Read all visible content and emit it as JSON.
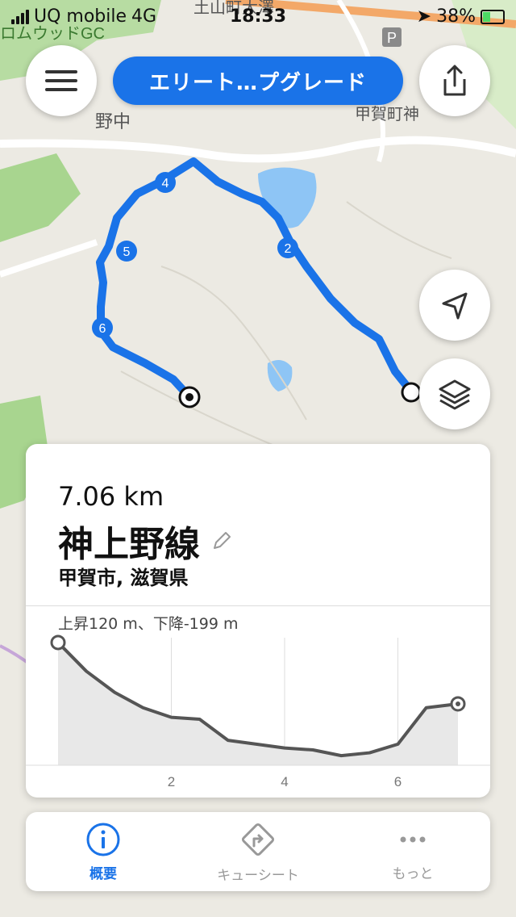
{
  "status_bar": {
    "carrier": "UQ mobile",
    "network": "4G",
    "time": "18:33",
    "battery": "38%"
  },
  "map": {
    "labels": [
      "ロムウッドGC",
      "野中",
      "甲賀町神",
      "土山町大澤",
      "P"
    ],
    "waypoints": [
      "4",
      "5",
      "6",
      "2"
    ]
  },
  "header": {
    "upgrade_label": "エリート…プグレード"
  },
  "route_card": {
    "distance": "7.06 km",
    "name": "神上野線",
    "location": "甲賀市, 滋賀県",
    "elevation_summary": "上昇120 m、下降-199 m"
  },
  "chart_data": {
    "type": "area",
    "x_ticks": [
      "2",
      "4",
      "6"
    ],
    "xlabel": "",
    "ylabel": "",
    "x": [
      0,
      0.5,
      1,
      1.5,
      2,
      2.5,
      3,
      3.5,
      4,
      4.5,
      5,
      5.5,
      6,
      6.5,
      7.06
    ],
    "y": [
      120,
      90,
      68,
      52,
      42,
      40,
      18,
      14,
      10,
      8,
      2,
      5,
      14,
      52,
      56
    ],
    "xlim": [
      0,
      7.06
    ]
  },
  "tabs": [
    {
      "label": "概要",
      "icon": "info-icon",
      "active": true
    },
    {
      "label": "キューシート",
      "icon": "turn-right-icon",
      "active": false
    },
    {
      "label": "もっと",
      "icon": "more-icon",
      "active": false
    }
  ],
  "colors": {
    "accent": "#1a73e8",
    "route": "#1a73e8",
    "water": "#8ec5f5",
    "forest": "#a8d58f"
  }
}
